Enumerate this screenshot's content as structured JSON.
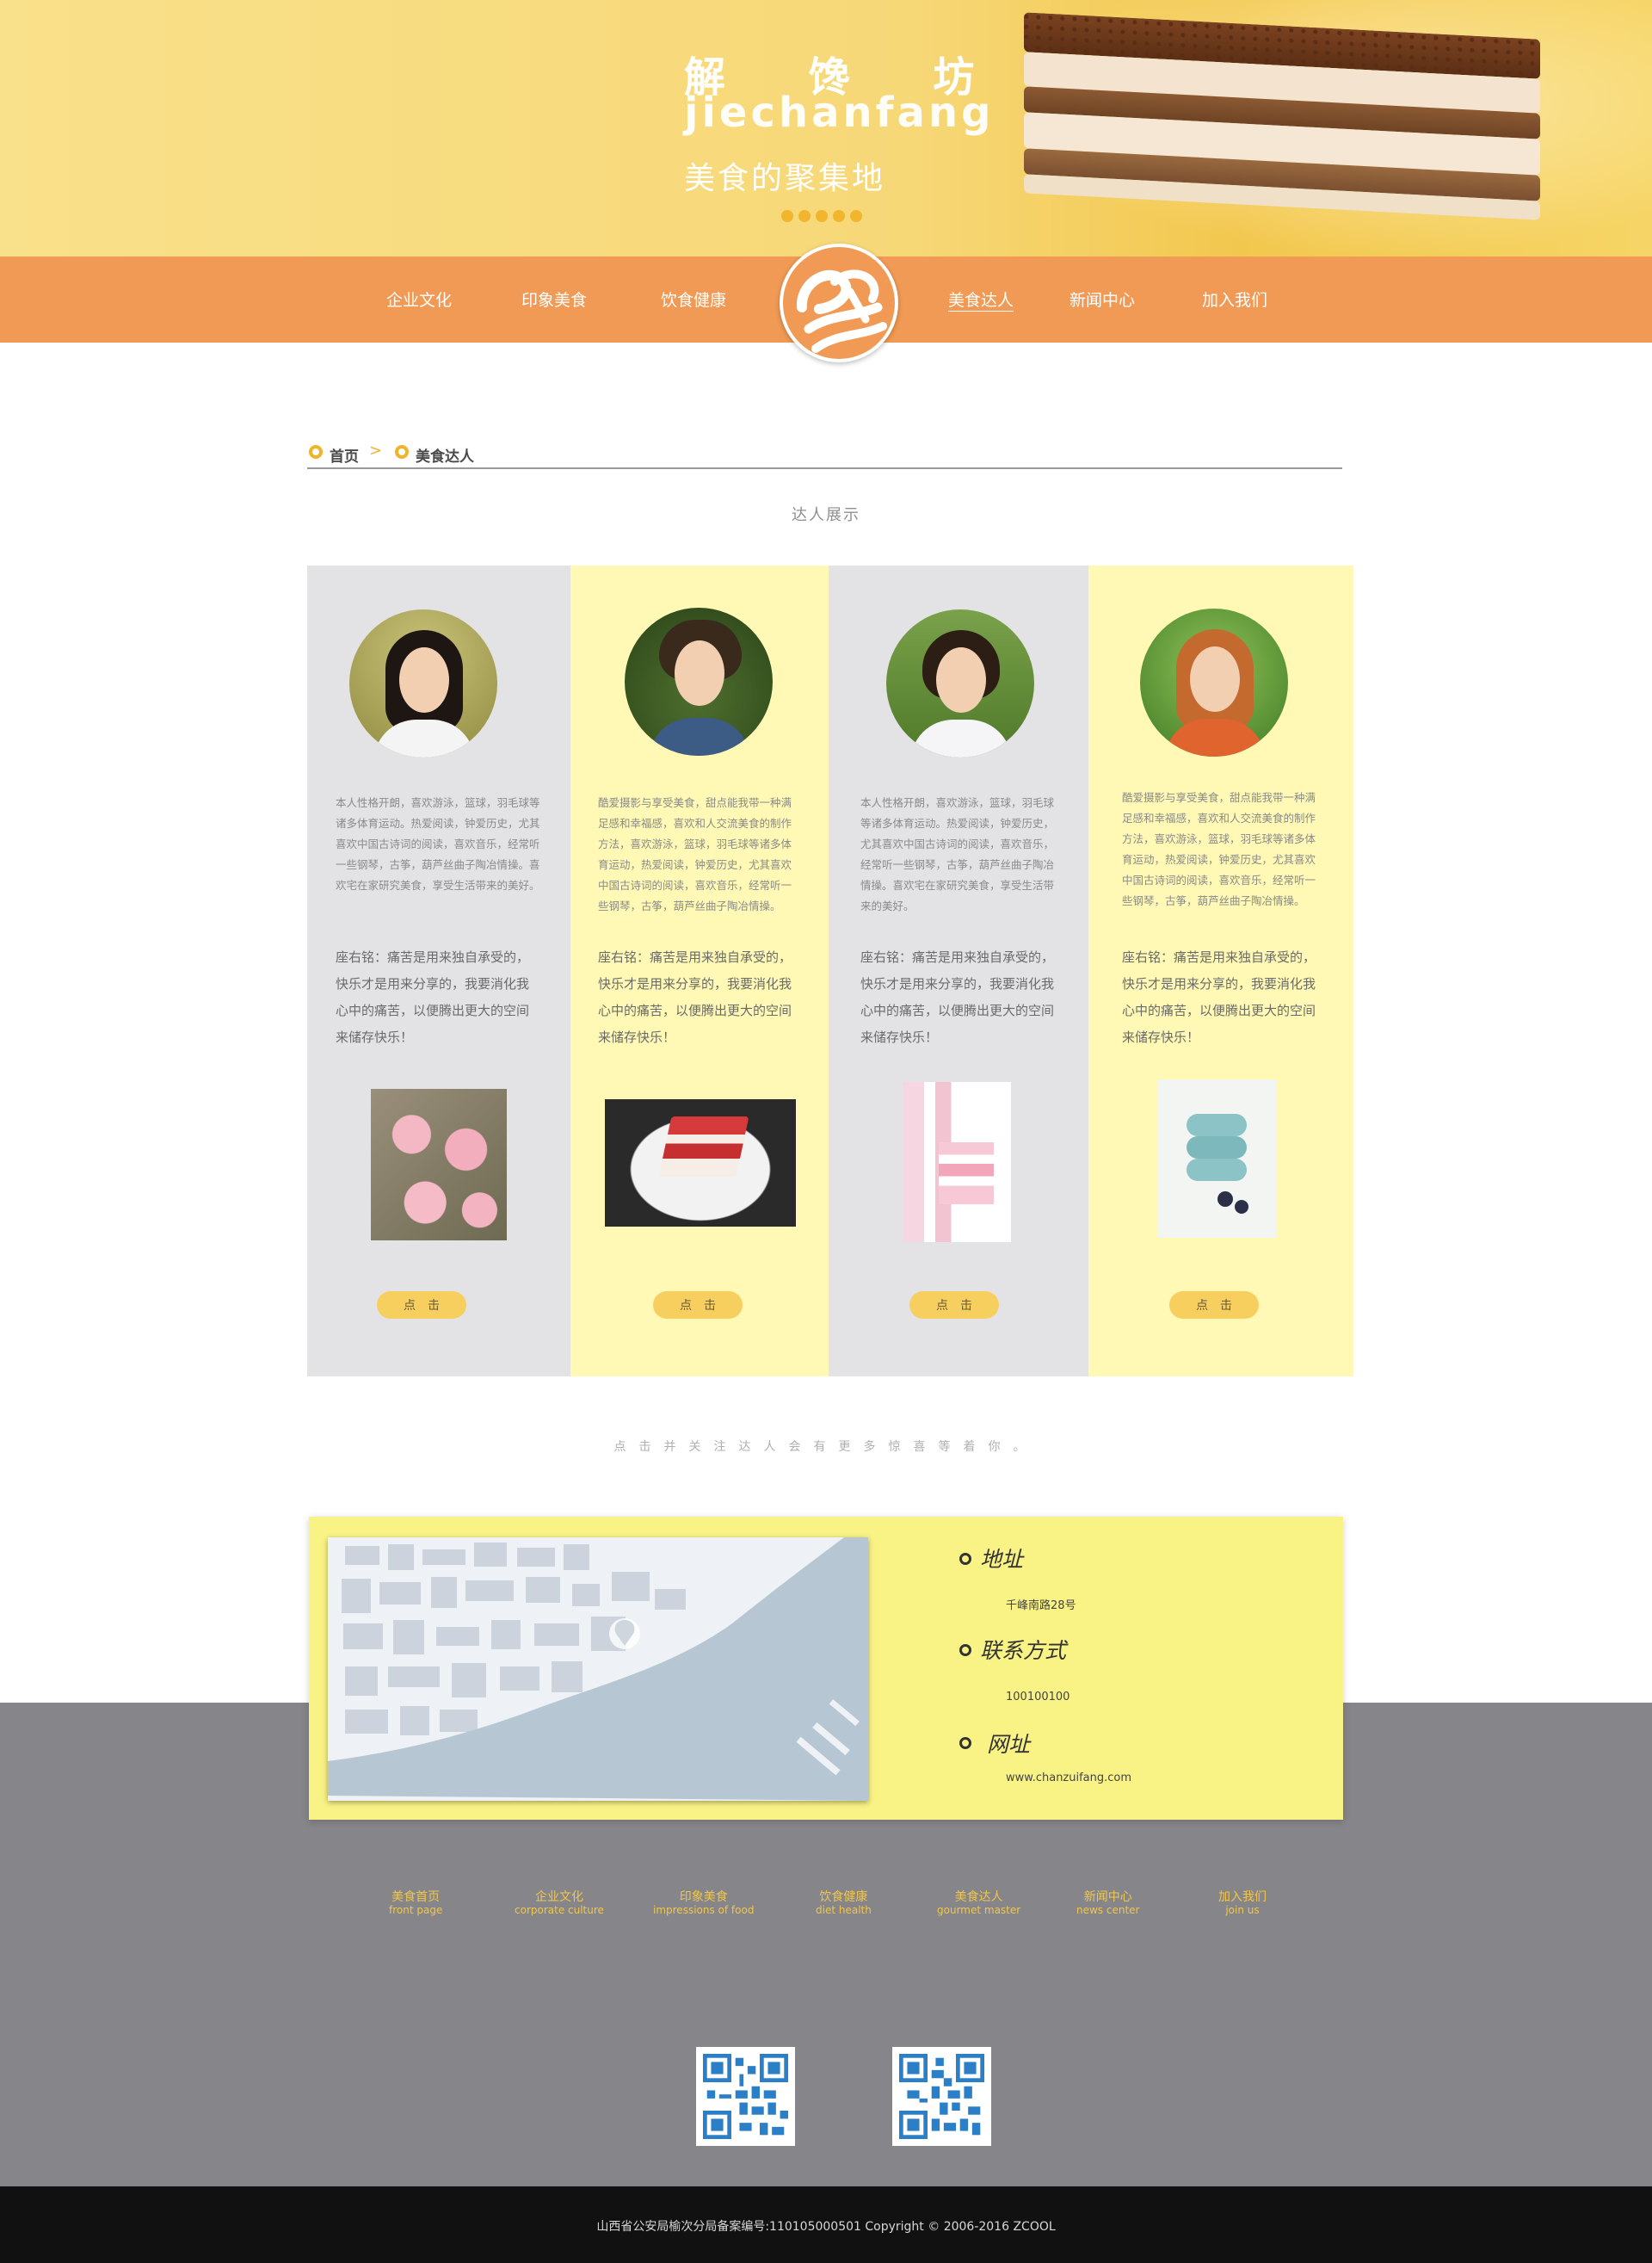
{
  "banner": {
    "title": "解 馋 坊",
    "subtitle": "jiechanfang",
    "slogan": "美食的聚集地"
  },
  "nav": {
    "items": [
      {
        "label": "企业文化"
      },
      {
        "label": "印象美食"
      },
      {
        "label": "饮食健康"
      },
      {
        "label": "美食达人",
        "active": true
      },
      {
        "label": "新闻中心"
      },
      {
        "label": "加入我们"
      }
    ]
  },
  "breadcrumb": {
    "home": "首页",
    "current": "美食达人",
    "separator": ">"
  },
  "section_title": "达人展示",
  "cards": [
    {
      "desc": "本人性格开朗，喜欢游泳，篮球，羽毛球等诸多体育运动。热爱阅读，钟爱历史，尤其喜欢中国古诗词的阅读，喜欢音乐，经常听一些钢琴，古筝，葫芦丝曲子陶冶情操。喜欢宅在家研究美食，享受生活带来的美好。",
      "motto": "座右铭：痛苦是用来独自承受的，快乐才是用来分享的，我要消化我心中的痛苦，以便腾出更大的空间来储存快乐！",
      "button": "点击"
    },
    {
      "desc": "酷爱摄影与享受美食，甜点能我带一种满足感和幸福感，喜欢和人交流美食的制作方法，喜欢游泳，篮球，羽毛球等诸多体育运动，热爱阅读，钟爱历史，尤其喜欢中国古诗词的阅读，喜欢音乐，经常听一些钢琴，古筝，葫芦丝曲子陶冶情操。",
      "motto": "座右铭：痛苦是用来独自承受的，快乐才是用来分享的，我要消化我心中的痛苦，以便腾出更大的空间来储存快乐！",
      "button": "点击"
    },
    {
      "desc": "本人性格开朗，喜欢游泳，篮球，羽毛球等诸多体育运动。热爱阅读，钟爱历史，尤其喜欢中国古诗词的阅读，喜欢音乐，经常听一些钢琴，古筝，葫芦丝曲子陶冶情操。喜欢宅在家研究美食，享受生活带来的美好。",
      "motto": "座右铭：痛苦是用来独自承受的，快乐才是用来分享的，我要消化我心中的痛苦，以便腾出更大的空间来储存快乐！",
      "button": "点击"
    },
    {
      "desc": "酷爱摄影与享受美食，甜点能我带一种满足感和幸福感，喜欢和人交流美食的制作方法，喜欢游泳，篮球，羽毛球等诸多体育运动，热爱阅读，钟爱历史，尤其喜欢中国古诗词的阅读，喜欢音乐，经常听一些钢琴，古筝，葫芦丝曲子陶冶情操。",
      "motto": "座右铭：痛苦是用来独自承受的，快乐才是用来分享的，我要消化我心中的痛苦，以便腾出更大的空间来储存快乐！",
      "button": "点击"
    }
  ],
  "follow_text": "点击并关注达人会有更多惊喜等着你。",
  "contact": {
    "address_label": "地址",
    "address_value": "千峰南路28号",
    "phone_label": "联系方式",
    "phone_value": "100100100",
    "site_label": "网址",
    "site_value": "www.chanzuifang.com"
  },
  "footer_links": [
    {
      "cn": "美食首页",
      "en": "front page"
    },
    {
      "cn": "企业文化",
      "en": "corporate culture"
    },
    {
      "cn": "印象美食",
      "en": "impressions of food"
    },
    {
      "cn": "饮食健康",
      "en": "diet health"
    },
    {
      "cn": "美食达人",
      "en": "gourmet master"
    },
    {
      "cn": "新闻中心",
      "en": "news center"
    },
    {
      "cn": "加入我们",
      "en": "join us"
    }
  ],
  "copyright": "山西省公安局榆次分局备案编号:110105000501    Copyright © 2006-2016 ZCOOL",
  "colors": {
    "nav_orange": "#f19a55",
    "banner_yellow": "#f7d877",
    "accent_gold": "#f2b22a",
    "card_gray": "#e3e3e6",
    "card_yellow": "#fff9b5",
    "contact_yellow": "#f9f284",
    "footer_gray": "#868589",
    "bottom_black": "#111111"
  },
  "icons": [
    "logo-mark",
    "breadcrumb-dot-icon",
    "chevron-right-icon",
    "contact-dot-icon",
    "qr-code-icon",
    "map-pin-icon"
  ]
}
